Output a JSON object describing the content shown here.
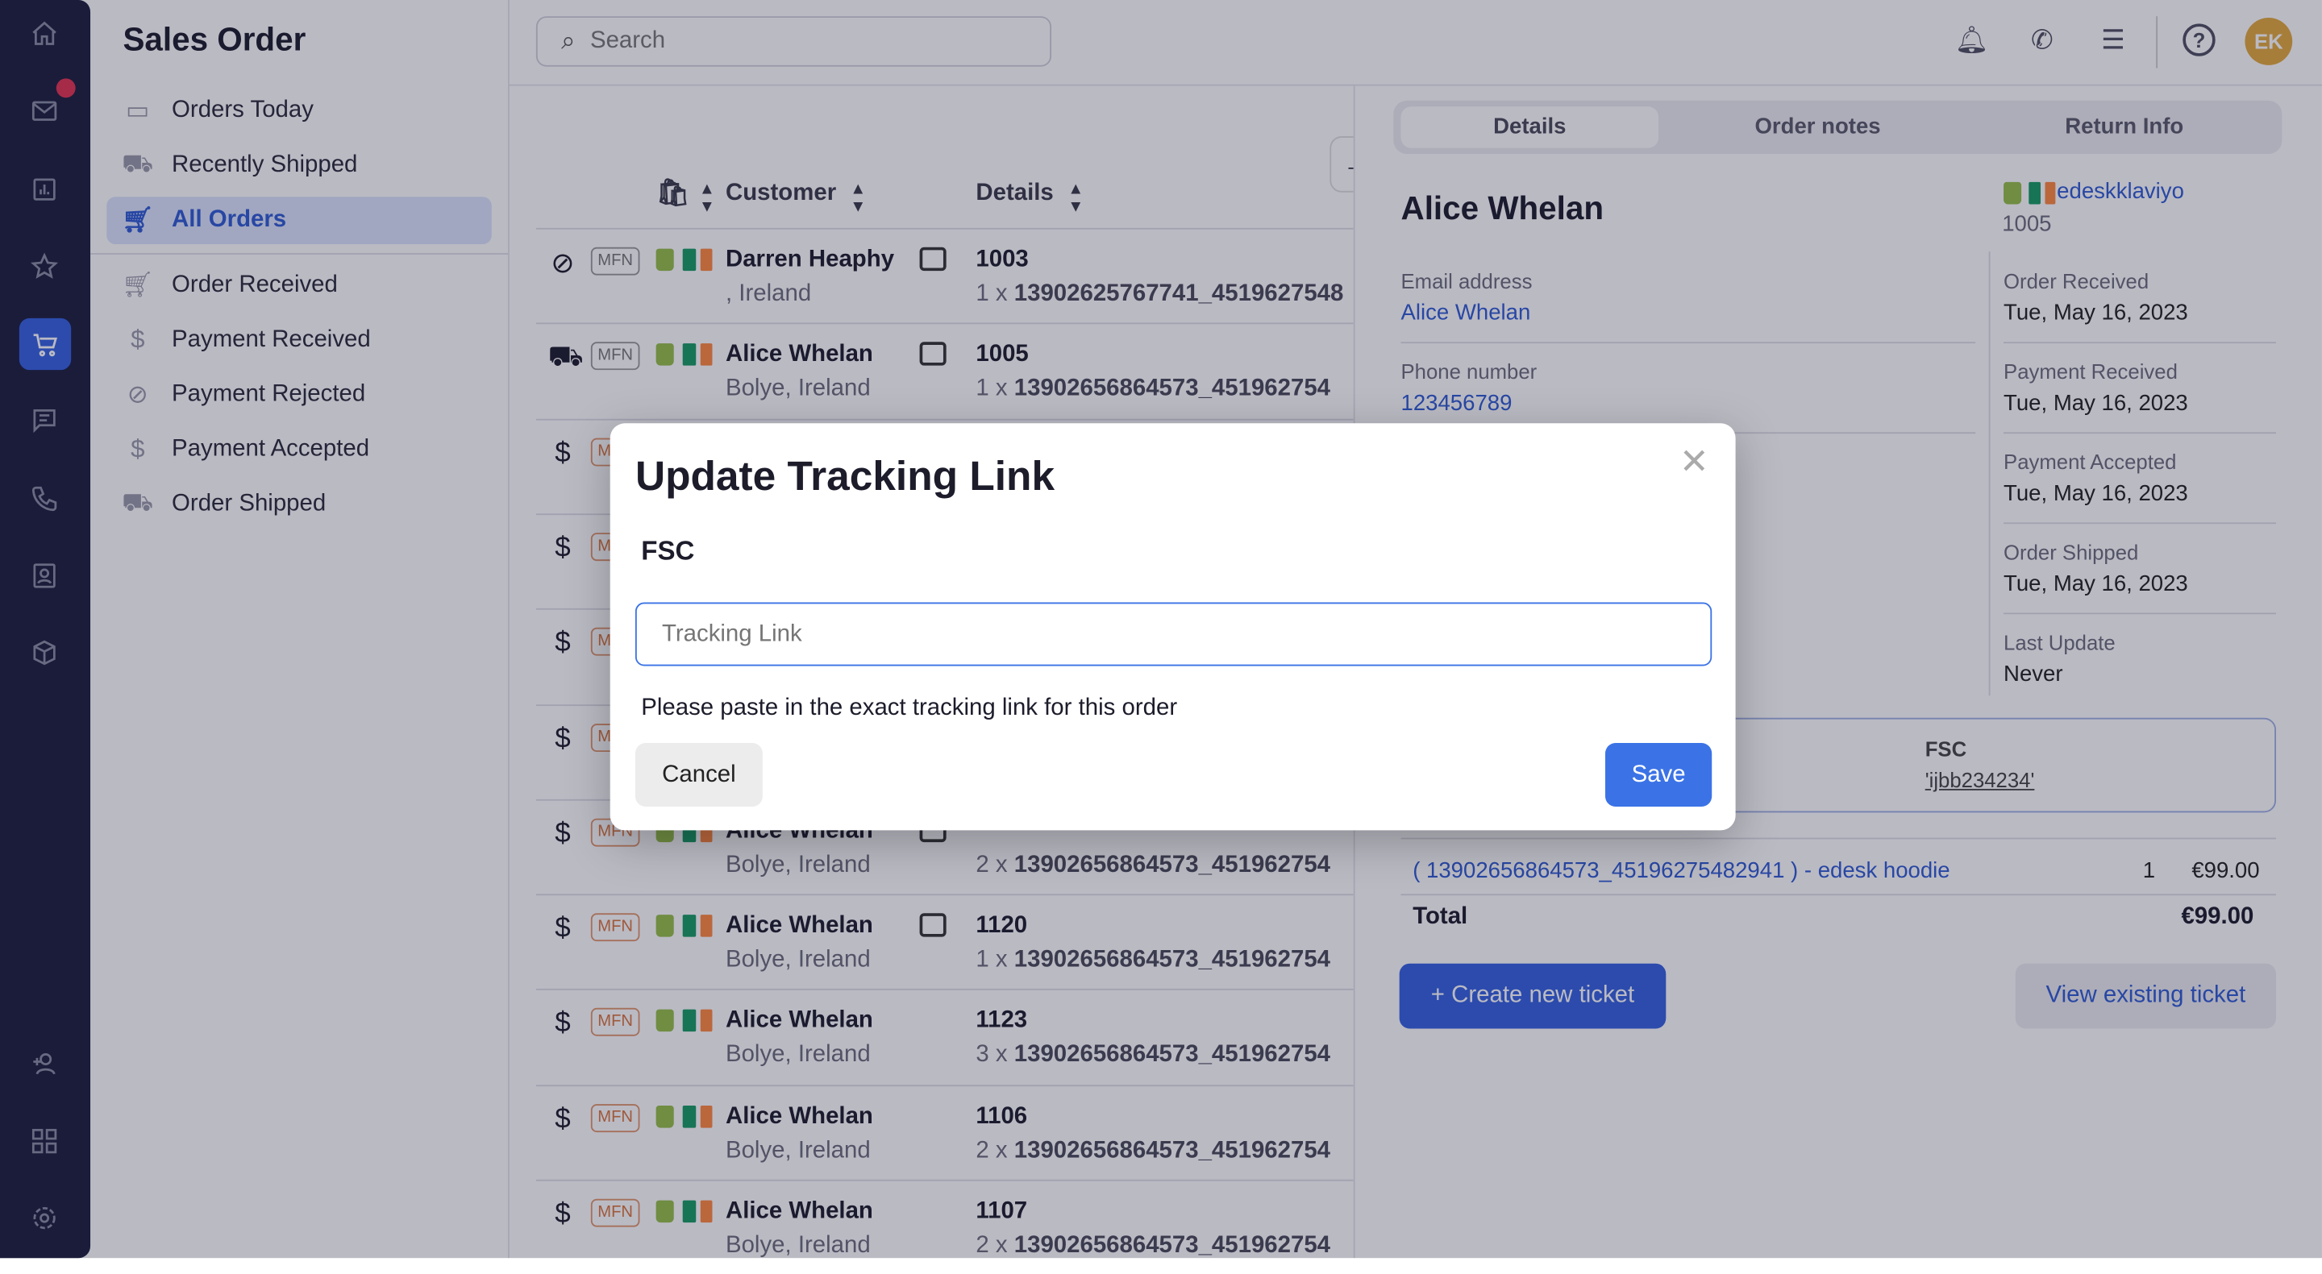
{
  "sidebar": {
    "title": "Sales Order",
    "items": [
      {
        "label": "Orders Today",
        "icon": "calendar-icon"
      },
      {
        "label": "Recently Shipped",
        "icon": "truck-icon"
      },
      {
        "label": "All Orders",
        "icon": "cart-icon",
        "active": true
      },
      {
        "label": "Order Received",
        "icon": "cart-icon"
      },
      {
        "label": "Payment Received",
        "icon": "dollar-icon"
      },
      {
        "label": "Payment Rejected",
        "icon": "ban-icon"
      },
      {
        "label": "Payment Accepted",
        "icon": "dollar-icon"
      },
      {
        "label": "Order Shipped",
        "icon": "truck-icon"
      }
    ]
  },
  "topbar": {
    "search_placeholder": "Search",
    "avatar_initials": "EK",
    "avatar_color": "#e2a93c"
  },
  "table": {
    "headers": {
      "customer": "Customer",
      "details": "Details"
    },
    "rows": [
      {
        "status": "ban",
        "badge": "MFN",
        "name": "Darren Heaphy",
        "location": ", Ireland",
        "email": true,
        "order": "1003",
        "qty": "1 x",
        "sku": "13902625767741_4519627548"
      },
      {
        "status": "truck",
        "badge": "MFN",
        "name": "Alice Whelan",
        "location": "Bolye, Ireland",
        "email": true,
        "order": "1005",
        "qty": "1 x",
        "sku": "13902656864573_451962754"
      },
      {
        "status": "dollar",
        "badge": "MFN",
        "name": "",
        "location": "",
        "email": false,
        "order": "",
        "qty": "",
        "sku": ""
      },
      {
        "status": "dollar",
        "badge": "MFN",
        "name": "",
        "location": "",
        "email": false,
        "order": "",
        "qty": "",
        "sku": ""
      },
      {
        "status": "dollar",
        "badge": "MFN",
        "name": "",
        "location": "",
        "email": false,
        "order": "",
        "qty": "",
        "sku": ""
      },
      {
        "status": "dollar",
        "badge": "MFN",
        "name": "",
        "location": "",
        "email": false,
        "order": "",
        "qty": "",
        "sku": ""
      },
      {
        "status": "dollar",
        "badge": "MFN",
        "name": "Alice Whelan",
        "location": "Bolye, Ireland",
        "email": true,
        "order": "",
        "qty": "2 x",
        "sku": "13902656864573_451962754"
      },
      {
        "status": "dollar",
        "badge": "MFN",
        "name": "Alice Whelan",
        "location": "Bolye, Ireland",
        "email": true,
        "order": "1120",
        "qty": "1 x",
        "sku": "13902656864573_451962754"
      },
      {
        "status": "dollar",
        "badge": "MFN",
        "name": "Alice Whelan",
        "location": "Bolye, Ireland",
        "email": false,
        "order": "1123",
        "qty": "3 x",
        "sku": "13902656864573_451962754"
      },
      {
        "status": "dollar",
        "badge": "MFN",
        "name": "Alice Whelan",
        "location": "Bolye, Ireland",
        "email": false,
        "order": "1106",
        "qty": "2 x",
        "sku": "13902656864573_451962754"
      },
      {
        "status": "dollar",
        "badge": "MFN",
        "name": "Alice Whelan",
        "location": "Bolye, Ireland",
        "email": false,
        "order": "1107",
        "qty": "2 x",
        "sku": "13902656864573_451962754"
      }
    ]
  },
  "detail": {
    "tabs": [
      "Details",
      "Order notes",
      "Return Info"
    ],
    "customer_name": "Alice Whelan",
    "channel": "edeskklaviyo",
    "order_number": "1005",
    "email_label": "Email address",
    "email_value": "Alice Whelan",
    "phone_label": "Phone number",
    "phone_value": "123456789",
    "timeline": [
      {
        "label": "Order Received",
        "value": "Tue, May 16, 2023"
      },
      {
        "label": "Payment Received",
        "value": "Tue, May 16, 2023"
      },
      {
        "label": "Payment Accepted",
        "value": "Tue, May 16, 2023"
      },
      {
        "label": "Order Shipped",
        "value": "Tue, May 16, 2023"
      },
      {
        "label": "Last Update",
        "value": "Never"
      }
    ],
    "tracking": {
      "carrier": "FSC",
      "code": "'ijbb234234'"
    },
    "item": {
      "name": "( 13902656864573_45196275482941 ) - edesk hoodie",
      "qty": "1",
      "price": "€99.00"
    },
    "total_label": "Total",
    "total_value": "€99.00",
    "create_ticket": "+ Create new ticket",
    "view_ticket": "View existing ticket"
  },
  "modal": {
    "title": "Update Tracking Link",
    "carrier": "FSC",
    "input_placeholder": "Tracking Link",
    "input_value": "",
    "help": "Please paste in the exact tracking link for this order",
    "cancel": "Cancel",
    "save": "Save"
  },
  "colors": {
    "accent": "#3461e0",
    "save": "#3b73e6",
    "flag_green": "#169b62",
    "flag_orange": "#ff883e"
  }
}
